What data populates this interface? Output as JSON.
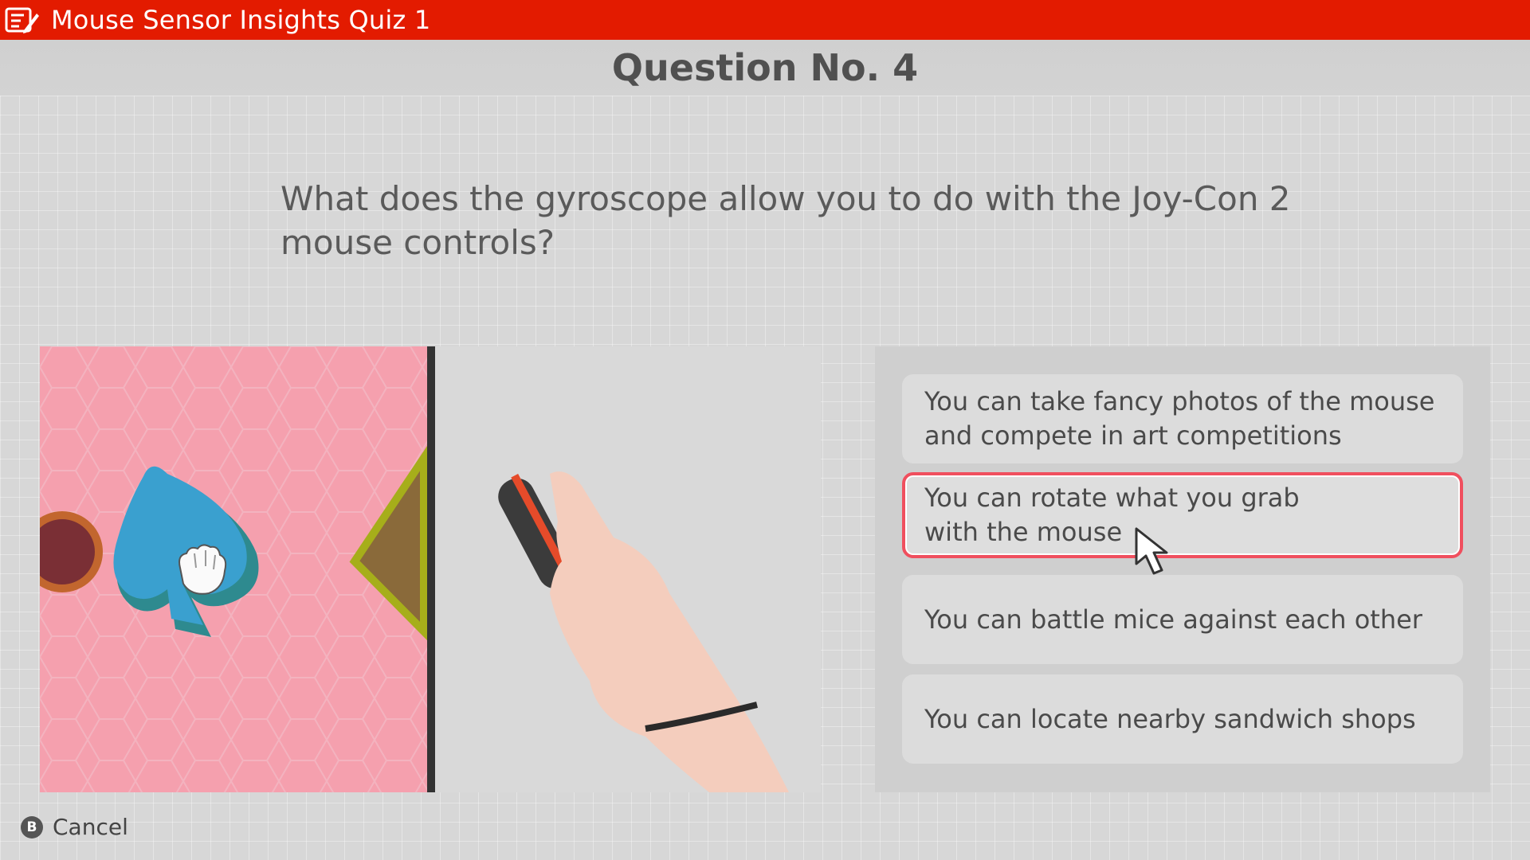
{
  "header": {
    "title": "Mouse Sensor Insights Quiz 1",
    "icon": "quiz-notepad-icon",
    "color": "#e31b00"
  },
  "question": {
    "number_label": "Question No. 4",
    "text": "What does the gyroscope allow you to do with the Joy-Con 2 mouse controls?"
  },
  "media": {
    "left_panel": "pink card-suit puzzle with grab hand cursor on blue spade",
    "right_panel": "hand rotating a Joy-Con 2 controller"
  },
  "options": [
    {
      "label": "You can take fancy photos of the mouse\nand compete in art competitions",
      "selected": false
    },
    {
      "label": "You can rotate what you grab\nwith the mouse",
      "selected": true
    },
    {
      "label": "You can battle mice against each other",
      "selected": false
    },
    {
      "label": "You can locate nearby sandwich shops",
      "selected": false
    }
  ],
  "footer": {
    "cancel_button": "B",
    "cancel_label": "Cancel"
  },
  "colors": {
    "accent": "#e31b00",
    "selection_border": "#f04f5e",
    "background": "#d7d7d7"
  }
}
